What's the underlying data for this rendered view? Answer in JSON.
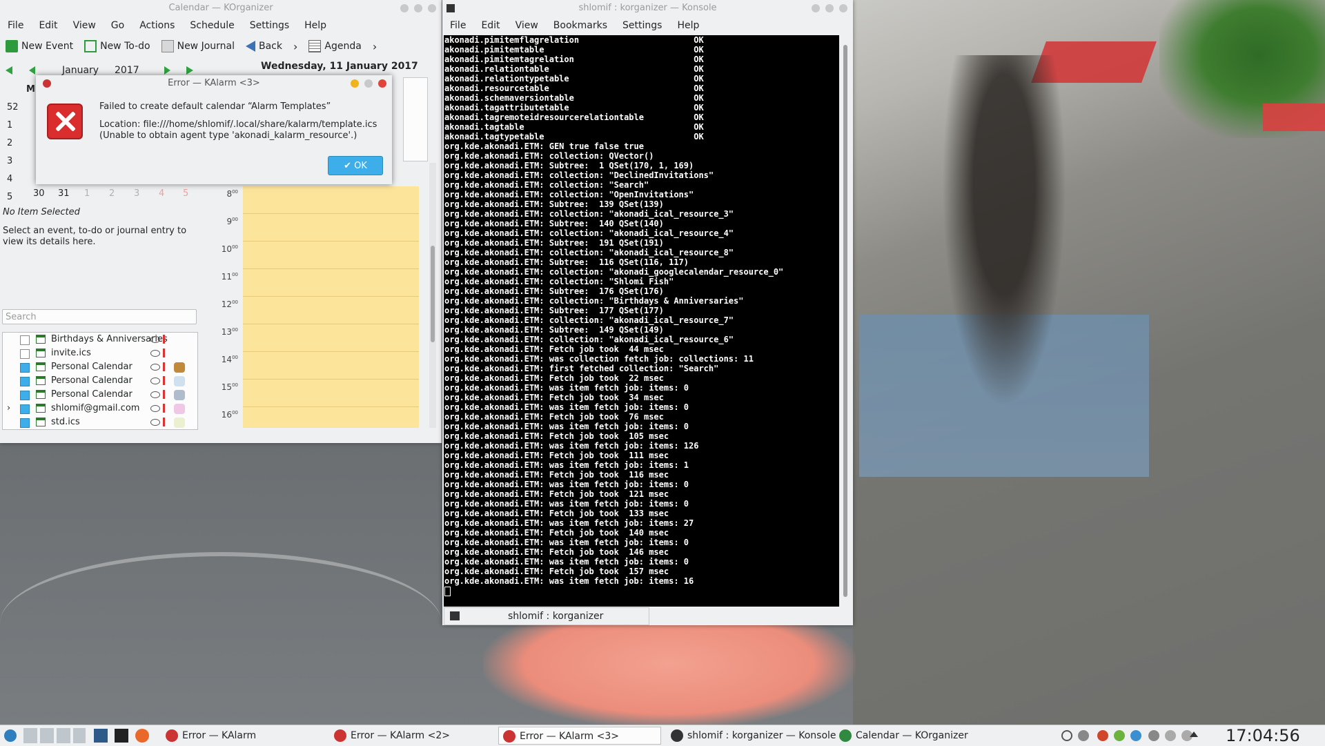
{
  "korganizer": {
    "title": "Calendar — KOrganizer",
    "menu": [
      "File",
      "Edit",
      "View",
      "Go",
      "Actions",
      "Schedule",
      "Settings",
      "Help"
    ],
    "toolbar": {
      "new_event": "New Event",
      "new_todo": "New To-do",
      "new_journal": "New Journal",
      "back": "Back",
      "agenda": "Agenda"
    },
    "nav": {
      "month": "January",
      "year": "2017"
    },
    "date_title": "Wednesday, 11 January 2017",
    "week_header": "M",
    "week_numbers": [
      "52",
      "1",
      "2",
      "3",
      "4",
      "5"
    ],
    "last_row_days": [
      "30",
      "31",
      "1",
      "2",
      "3",
      "4",
      "5"
    ],
    "no_item": "No Item Selected",
    "hint": "Select an event, to-do or journal entry to view its details here.",
    "search_placeholder": "Search",
    "calendars": [
      {
        "label": "Birthdays & Anniversaries",
        "checked": false,
        "color": ""
      },
      {
        "label": "invite.ics",
        "checked": false,
        "color": ""
      },
      {
        "label": "Personal Calendar",
        "checked": true,
        "color": "#c08a3a"
      },
      {
        "label": "Personal Calendar",
        "checked": true,
        "color": "#cfe0ee"
      },
      {
        "label": "Personal Calendar",
        "checked": true,
        "color": "#aebccb"
      },
      {
        "label": "shlomif@gmail.com",
        "checked": true,
        "color": "#f0c8e6"
      },
      {
        "label": "std.ics",
        "checked": true,
        "color": "#eaf0d0"
      }
    ],
    "hours": [
      "8",
      "9",
      "10",
      "11",
      "12",
      "13",
      "14",
      "15",
      "16"
    ],
    "hour_suffix": "00"
  },
  "kalarm": {
    "title": "Error — KAlarm <3>",
    "message": "Failed to create default calendar “Alarm Templates”",
    "location": "Location: file:///home/shlomif/.local/share/kalarm/template.ics",
    "detail": "(Unable to obtain agent type 'akonadi_kalarm_resource'.)",
    "ok": "OK"
  },
  "konsole": {
    "title": "shlomif : korganizer — Konsole",
    "menu": [
      "File",
      "Edit",
      "View",
      "Bookmarks",
      "Settings",
      "Help"
    ],
    "tab": "shlomif : korganizer",
    "lines": [
      "akonadi.pimitemflagrelation                       OK",
      "akonadi.pimitemtable                              OK",
      "akonadi.pimitemtagrelation                        OK",
      "akonadi.relationtable                             OK",
      "akonadi.relationtypetable                         OK",
      "akonadi.resourcetable                             OK",
      "akonadi.schemaversiontable                        OK",
      "akonadi.tagattributetable                         OK",
      "akonadi.tagremoteidresourcerelationtable          OK",
      "akonadi.tagtable                                  OK",
      "akonadi.tagtypetable                              OK",
      "org.kde.akonadi.ETM: GEN true false true",
      "org.kde.akonadi.ETM: collection: QVector()",
      "org.kde.akonadi.ETM: Subtree:  1 QSet(170, 1, 169)",
      "org.kde.akonadi.ETM: collection: \"DeclinedInvitations\"",
      "org.kde.akonadi.ETM: collection: \"Search\"",
      "org.kde.akonadi.ETM: collection: \"OpenInvitations\"",
      "org.kde.akonadi.ETM: Subtree:  139 QSet(139)",
      "org.kde.akonadi.ETM: collection: \"akonadi_ical_resource_3\"",
      "org.kde.akonadi.ETM: Subtree:  140 QSet(140)",
      "org.kde.akonadi.ETM: collection: \"akonadi_ical_resource_4\"",
      "org.kde.akonadi.ETM: Subtree:  191 QSet(191)",
      "org.kde.akonadi.ETM: collection: \"akonadi_ical_resource_8\"",
      "org.kde.akonadi.ETM: Subtree:  116 QSet(116, 117)",
      "org.kde.akonadi.ETM: collection: \"akonadi_googlecalendar_resource_0\"",
      "org.kde.akonadi.ETM: collection: \"Shlomi Fish\"",
      "org.kde.akonadi.ETM: Subtree:  176 QSet(176)",
      "org.kde.akonadi.ETM: collection: \"Birthdays & Anniversaries\"",
      "org.kde.akonadi.ETM: Subtree:  177 QSet(177)",
      "org.kde.akonadi.ETM: collection: \"akonadi_ical_resource_7\"",
      "org.kde.akonadi.ETM: Subtree:  149 QSet(149)",
      "org.kde.akonadi.ETM: collection: \"akonadi_ical_resource_6\"",
      "org.kde.akonadi.ETM: Fetch job took  44 msec",
      "org.kde.akonadi.ETM: was collection fetch job: collections: 11",
      "org.kde.akonadi.ETM: first fetched collection: \"Search\"",
      "org.kde.akonadi.ETM: Fetch job took  22 msec",
      "org.kde.akonadi.ETM: was item fetch job: items: 0",
      "org.kde.akonadi.ETM: Fetch job took  34 msec",
      "org.kde.akonadi.ETM: was item fetch job: items: 0",
      "org.kde.akonadi.ETM: Fetch job took  76 msec",
      "org.kde.akonadi.ETM: was item fetch job: items: 0",
      "org.kde.akonadi.ETM: Fetch job took  105 msec",
      "org.kde.akonadi.ETM: was item fetch job: items: 126",
      "org.kde.akonadi.ETM: Fetch job took  111 msec",
      "org.kde.akonadi.ETM: was item fetch job: items: 1",
      "org.kde.akonadi.ETM: Fetch job took  116 msec",
      "org.kde.akonadi.ETM: was item fetch job: items: 0",
      "org.kde.akonadi.ETM: Fetch job took  121 msec",
      "org.kde.akonadi.ETM: was item fetch job: items: 0",
      "org.kde.akonadi.ETM: Fetch job took  133 msec",
      "org.kde.akonadi.ETM: was item fetch job: items: 27",
      "org.kde.akonadi.ETM: Fetch job took  140 msec",
      "org.kde.akonadi.ETM: was item fetch job: items: 0",
      "org.kde.akonadi.ETM: Fetch job took  146 msec",
      "org.kde.akonadi.ETM: was item fetch job: items: 0",
      "org.kde.akonadi.ETM: Fetch job took  157 msec",
      "org.kde.akonadi.ETM: was item fetch job: items: 16"
    ]
  },
  "taskbar": {
    "tasks": [
      "Error — KAlarm",
      "Error — KAlarm <2>",
      "Error — KAlarm <3>",
      "shlomif : korganizer — Konsole",
      "Calendar — KOrganizer"
    ],
    "clock": "17:04:56"
  },
  "colors": {
    "accent": "#3daee9",
    "error": "#da2d2d",
    "agenda_slot": "#fde49b"
  }
}
